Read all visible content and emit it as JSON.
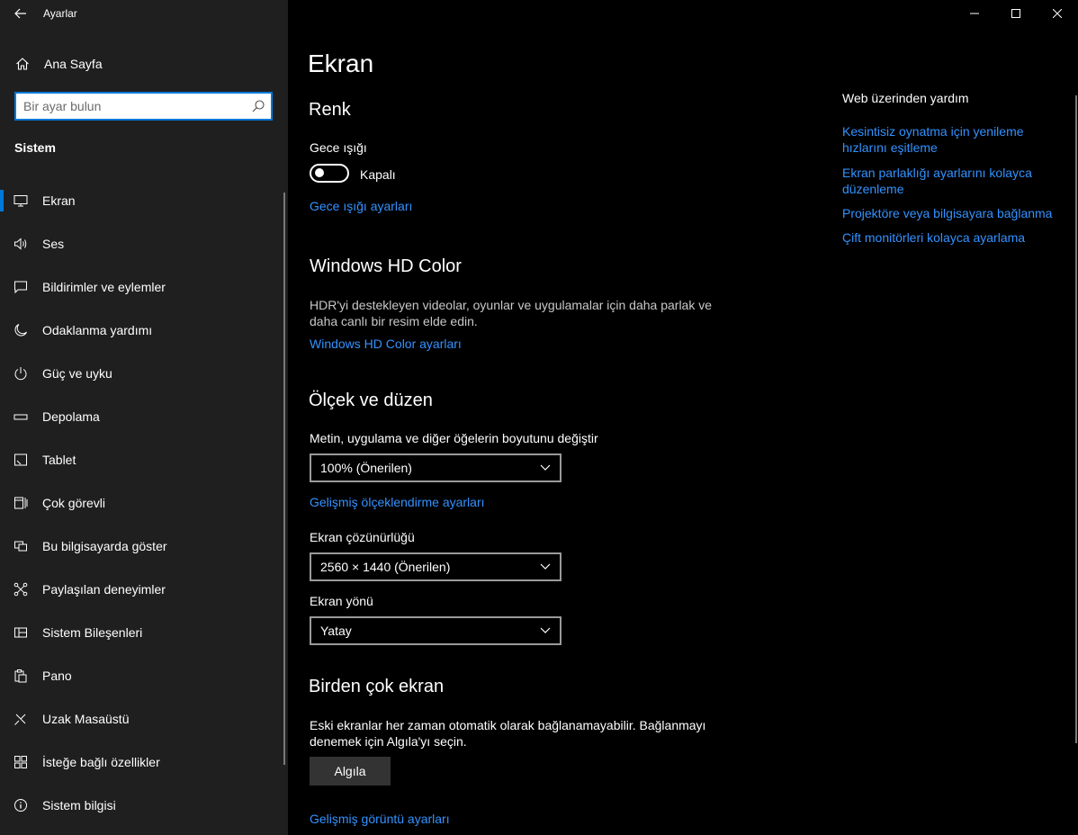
{
  "app": {
    "title": "Ayarlar"
  },
  "sidebar": {
    "home_label": "Ana Sayfa",
    "search_placeholder": "Bir ayar bulun",
    "section_heading": "Sistem",
    "items": [
      {
        "label": "Ekran",
        "icon": "monitor-icon",
        "selected": true
      },
      {
        "label": "Ses",
        "icon": "speaker-icon"
      },
      {
        "label": "Bildirimler ve eylemler",
        "icon": "notification-icon"
      },
      {
        "label": "Odaklanma yardımı",
        "icon": "moon-icon"
      },
      {
        "label": "Güç ve uyku",
        "icon": "power-icon"
      },
      {
        "label": "Depolama",
        "icon": "storage-icon"
      },
      {
        "label": "Tablet",
        "icon": "tablet-icon"
      },
      {
        "label": "Çok görevli",
        "icon": "multitasking-icon"
      },
      {
        "label": "Bu bilgisayarda göster",
        "icon": "project-icon"
      },
      {
        "label": "Paylaşılan deneyimler",
        "icon": "shared-experiences-icon"
      },
      {
        "label": "Sistem Bileşenleri",
        "icon": "components-icon"
      },
      {
        "label": "Pano",
        "icon": "clipboard-icon"
      },
      {
        "label": "Uzak Masaüstü",
        "icon": "remote-desktop-icon"
      },
      {
        "label": "İsteğe bağlı özellikler",
        "icon": "optional-features-icon"
      },
      {
        "label": "Sistem bilgisi",
        "icon": "info-icon"
      }
    ]
  },
  "main": {
    "page_title": "Ekran",
    "color": {
      "heading": "Renk",
      "night_light_label": "Gece ışığı",
      "night_light_state": "Kapalı",
      "night_light_settings_link": "Gece ışığı ayarları"
    },
    "hdr": {
      "heading": "Windows HD Color",
      "description": "HDR'yi destekleyen videolar, oyunlar ve uygulamalar için daha parlak ve daha canlı bir resim elde edin.",
      "settings_link": "Windows HD Color ayarları"
    },
    "scale": {
      "heading": "Ölçek ve düzen",
      "scale_label": "Metin, uygulama ve diğer öğelerin boyutunu değiştir",
      "scale_value": "100% (Önerilen)",
      "advanced_scaling_link": "Gelişmiş ölçeklendirme ayarları",
      "resolution_label": "Ekran çözünürlüğü",
      "resolution_value": "2560 × 1440 (Önerilen)",
      "orientation_label": "Ekran yönü",
      "orientation_value": "Yatay"
    },
    "multiple": {
      "heading": "Birden çok ekran",
      "description": "Eski ekranlar her zaman otomatik olarak bağlanamayabilir. Bağlanmayı denemek için Algıla'yı seçin.",
      "detect_button": "Algıla",
      "advanced_display_link": "Gelişmiş görüntü ayarları"
    }
  },
  "help": {
    "title": "Web üzerinden yardım",
    "links": [
      "Kesintisiz oynatma için yenileme hızlarını eşitleme",
      "Ekran parlaklığı ayarlarını kolayca düzenleme",
      "Projektöre veya bilgisayara bağlanma",
      "Çift monitörleri kolayca ayarlama"
    ]
  },
  "colors": {
    "accent": "#0078d7",
    "link": "#3392ff",
    "sidebar_bg": "#1f1f1f",
    "main_bg": "#000000"
  }
}
